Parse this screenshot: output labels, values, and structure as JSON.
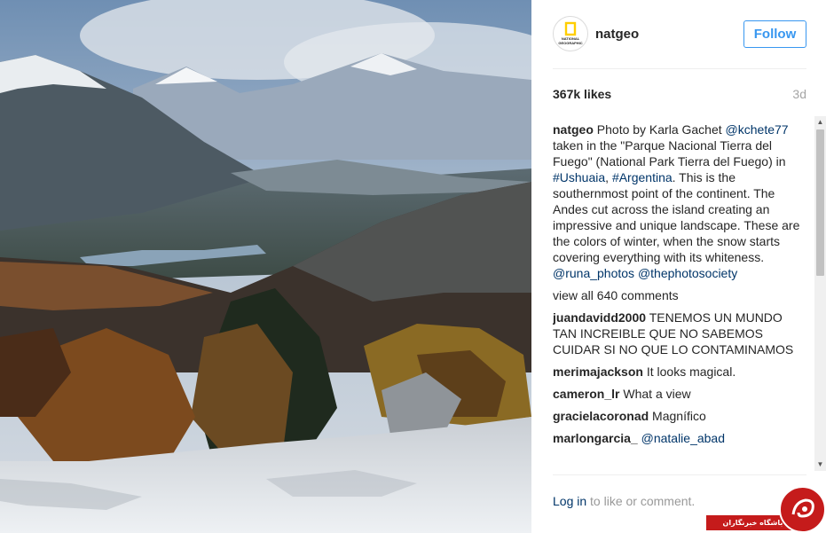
{
  "post": {
    "header": {
      "username": "natgeo",
      "follow_label": "Follow"
    },
    "likes": "367k likes",
    "age": "3d",
    "caption": {
      "username": "natgeo",
      "text_1": " Photo by Karla Gachet ",
      "mention_1": "@kchete77",
      "text_2": " taken in the \"Parque Nacional Tierra del Fuego\" (National Park Tierra del Fuego) in ",
      "hashtag_1": "#Ushuaia",
      "text_3": ", ",
      "hashtag_2": "#Argentina",
      "text_4": ". This is the southernmost point of the continent. The Andes cut across the island creating an impressive and unique landscape. These are the colors of winter, when the snow starts covering everything with its whiteness. ",
      "mention_2": "@runa_photos",
      "mention_3": "@thephotosociety"
    },
    "view_all_comments": "view all 640 comments",
    "comments": [
      {
        "username": "juandavidd2000",
        "text": "TENEMOS UN MUNDO TAN INCREIBLE QUE NO SABEMOS CUIDAR SI NO QUE LO CONTAMINAMOS"
      },
      {
        "username": "merimajackson",
        "text": "It looks magical."
      },
      {
        "username": "cameron_lr",
        "text": "What a view"
      },
      {
        "username": "gracielacoronad",
        "text": "Magnífico"
      },
      {
        "username": "marlongarcia_",
        "text": "@natalie_abad"
      }
    ],
    "add_comment": {
      "login_label": "Log in",
      "suffix": " to like or comment."
    }
  },
  "avatar_logo": {
    "line1": "NATIONAL",
    "line2": "GEOGRAPHIC"
  },
  "watermark": {
    "text": "باشگاه خبرنگاران"
  },
  "colors": {
    "follow_blue": "#3897f0",
    "link_blue": "#003569",
    "muted_gray": "#999999",
    "watermark_red": "#c51b1b",
    "natgeo_yellow": "#ffce00"
  }
}
